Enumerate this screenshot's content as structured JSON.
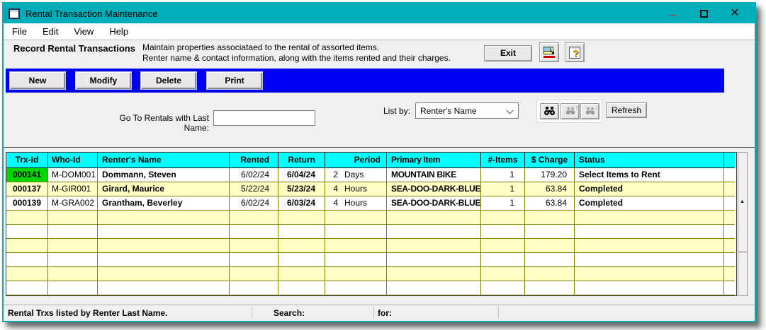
{
  "window": {
    "title": "Rental Transaction Maintenance",
    "controls": {
      "minimize": "minimize",
      "maximize": "maximize",
      "close": "close"
    }
  },
  "menu": {
    "file": "File",
    "edit": "Edit",
    "view": "View",
    "help": "Help"
  },
  "header": {
    "title": "Record Rental Transactions",
    "desc1": "Maintain properties associataed to the rental of assorted items.",
    "desc2": "Renter name & contact information, along with the items rented and their charges.",
    "exit_label": "Exit",
    "icons": [
      "print-icon",
      "help-icon"
    ]
  },
  "toolbar": {
    "new": "New",
    "modify": "Modify",
    "delete": "Delete",
    "print": "Print"
  },
  "filter": {
    "goto_label": "Go To Rentals with Last Name:",
    "goto_value": "",
    "listby_label": "List by:",
    "listby_value": "Renter's Name",
    "find_icons": [
      "find-icon",
      "find-previous-icon",
      "find-next-icon"
    ],
    "refresh_label": "Refresh"
  },
  "table": {
    "columns": {
      "trx": "Trx-Id",
      "who": "Who-Id",
      "name": "Renter's Name",
      "rented": "Rented",
      "return": "Return",
      "period": "Period",
      "item": "Primary Item",
      "items": "#-Items",
      "charge": "$ Charge",
      "status": "Status"
    },
    "rows": [
      {
        "trx_id": "000141",
        "who_id": "M-DOM001",
        "name": "Dommann, Steven",
        "rented": "6/02/24",
        "return": "6/04/24",
        "period_n": "2",
        "period_u": "Days",
        "item": "MOUNTAIN BIKE",
        "items": "1",
        "charge": "179.20",
        "status": "Select Items to Rent",
        "selected": true
      },
      {
        "trx_id": "000137",
        "who_id": "M-GIR001",
        "name": "Girard, Maurice",
        "rented": "5/22/24",
        "return": "5/23/24",
        "period_n": "4",
        "period_u": "Hours",
        "item": "SEA-DOO-DARK-BLUE",
        "items": "1",
        "charge": "63.84",
        "status": "Completed",
        "selected": false
      },
      {
        "trx_id": "000139",
        "who_id": "M-GRA002",
        "name": "Grantham, Beverley",
        "rented": "6/02/24",
        "return": "6/03/24",
        "period_n": "4",
        "period_u": "Hours",
        "item": "SEA-DOO-DARK-BLUE",
        "items": "1",
        "charge": "63.84",
        "status": "Completed",
        "selected": false
      }
    ],
    "empty_row_count": 6
  },
  "statusbar": {
    "left_text": "Rental Trxs listed by Renter Last Name.",
    "search_label": "Search:",
    "for_label": "for:"
  },
  "colors": {
    "titlebar_teal": "#00adb9",
    "toolbar_blue": "#0000f5",
    "header_cyan": "#00ffff",
    "selected_green": "#00d600",
    "row_yellow": "#ffffc6",
    "grid_olive": "#808000"
  }
}
